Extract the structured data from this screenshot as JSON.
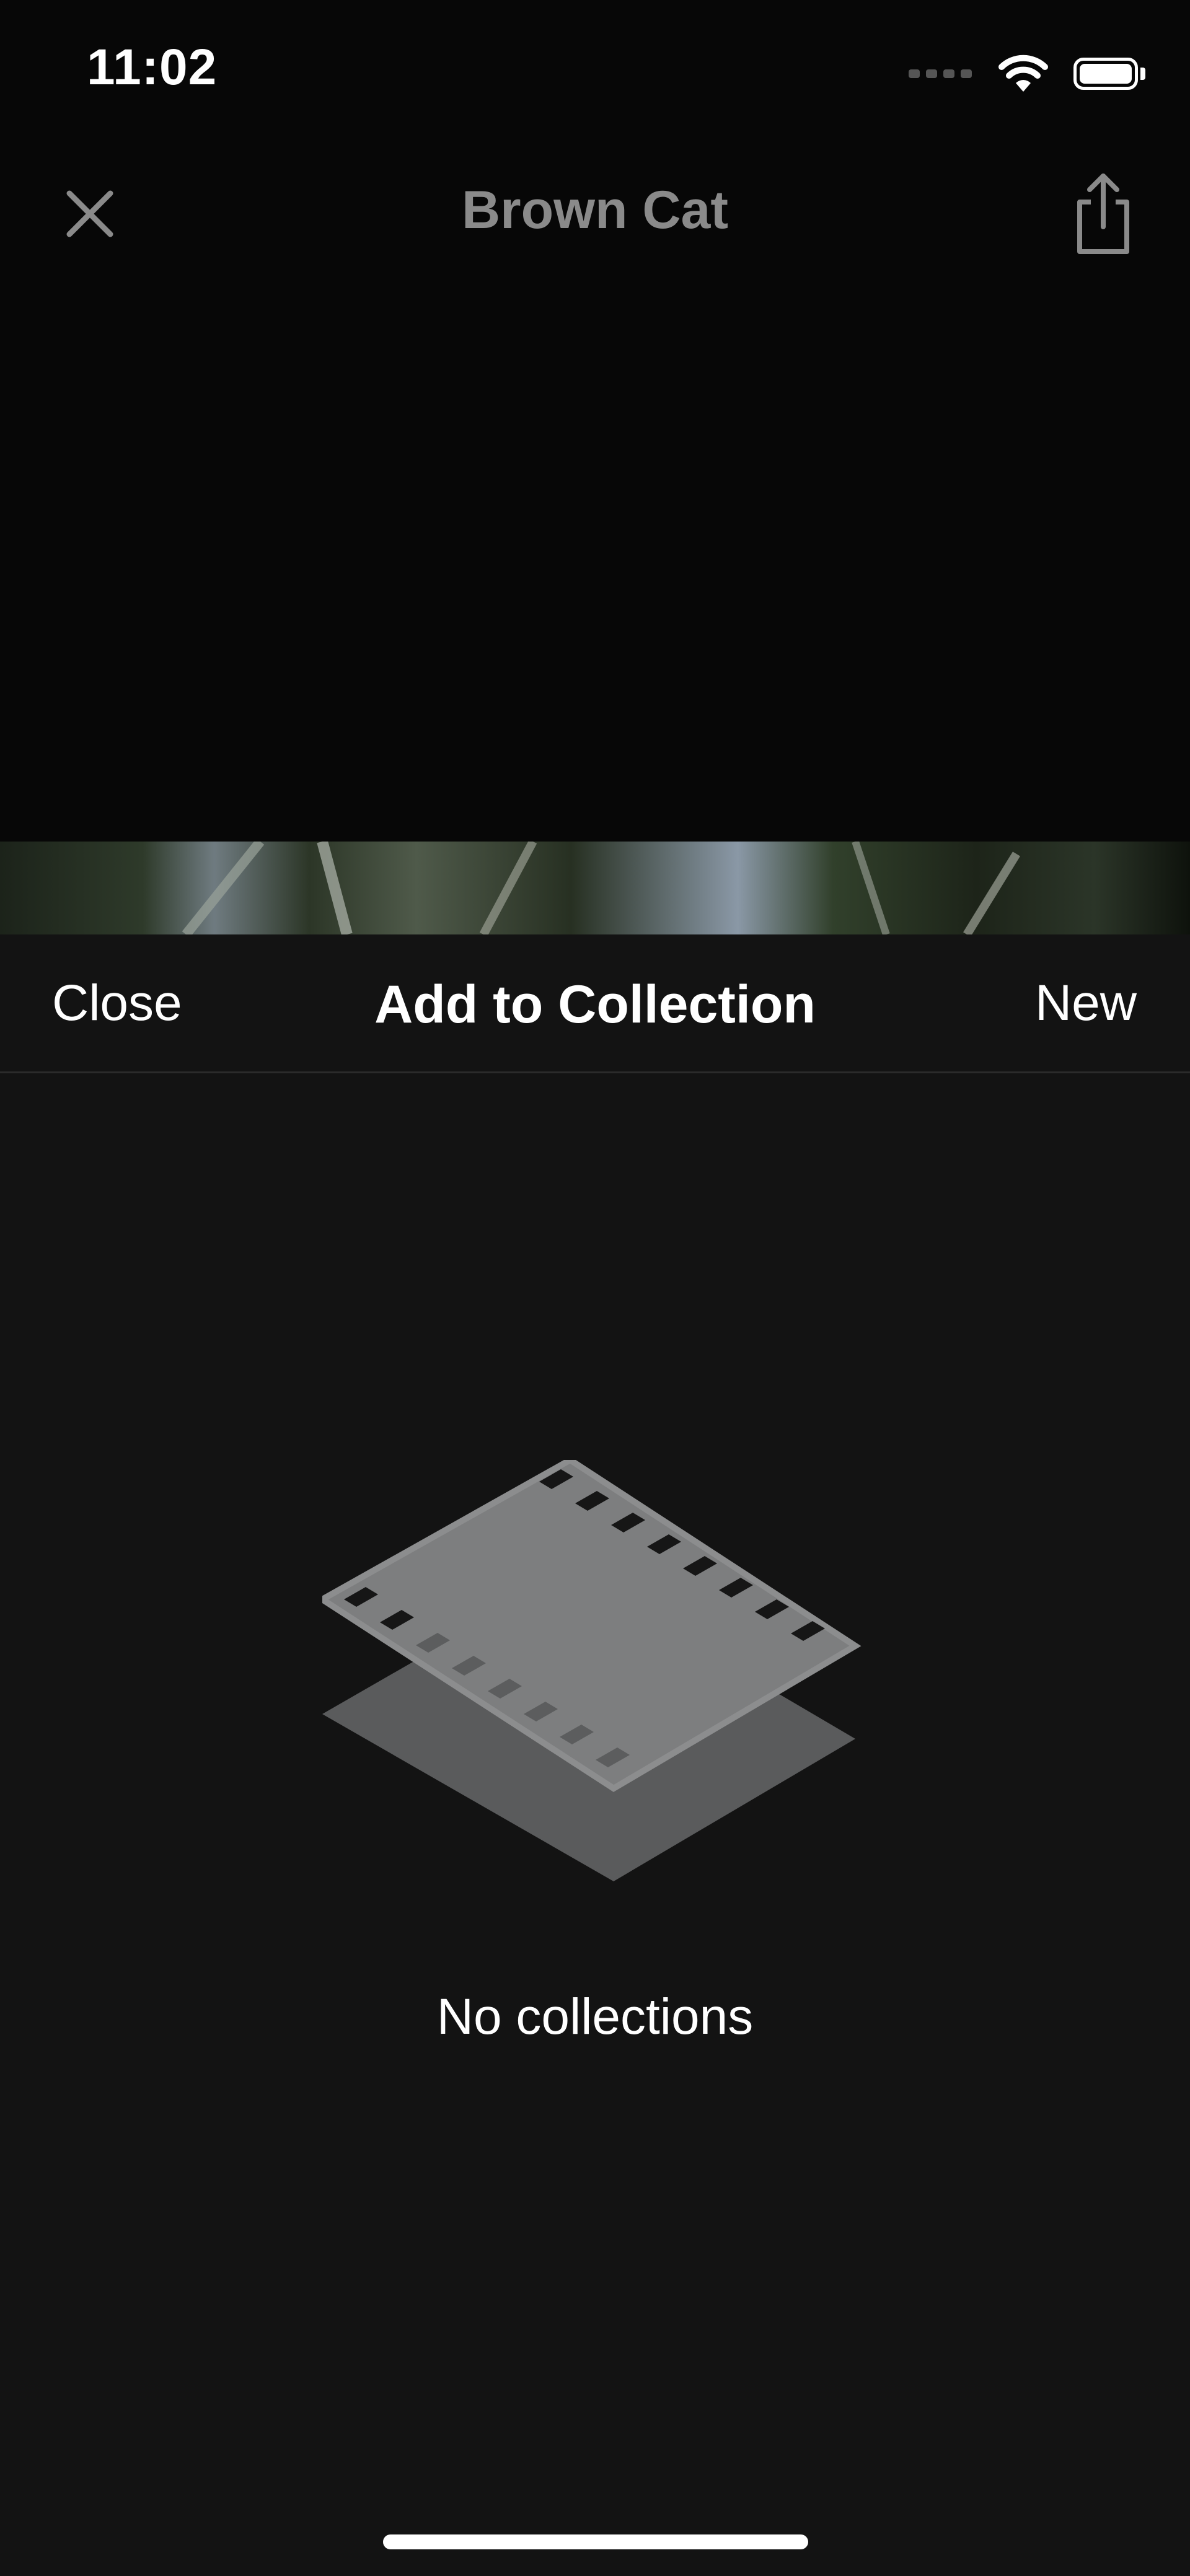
{
  "status_bar": {
    "time": "11:02",
    "icons": [
      "cellular-signal-icon",
      "wifi-icon",
      "battery-icon"
    ]
  },
  "top_nav": {
    "title": "Brown Cat",
    "close_icon": "close-icon",
    "share_icon": "share-icon"
  },
  "sheet": {
    "close_label": "Close",
    "title": "Add to Collection",
    "new_label": "New",
    "empty_state": {
      "icon": "film-strip-stack-icon",
      "message": "No collections"
    }
  },
  "colors": {
    "background": "#070707",
    "sheet_background": "#131313",
    "muted_title": "#8a8a8a",
    "text": "#ffffff"
  }
}
